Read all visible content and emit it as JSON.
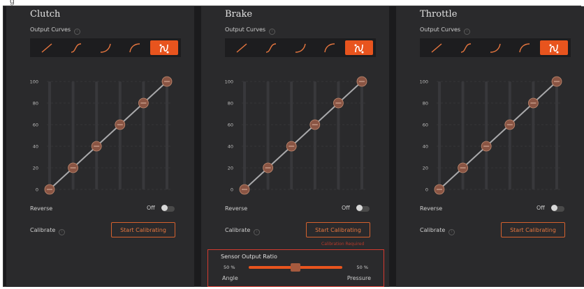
{
  "top_text": "g",
  "panels": [
    {
      "title": "Clutch",
      "output_curves_label": "Output Curves",
      "reverse_label": "Reverse",
      "reverse_state": "Off",
      "calibrate_label": "Calibrate",
      "calibrate_button": "Start Calibrating",
      "warning": ""
    },
    {
      "title": "Brake",
      "output_curves_label": "Output Curves",
      "reverse_label": "Reverse",
      "reverse_state": "Off",
      "calibrate_label": "Calibrate",
      "calibrate_button": "Start Calibrating",
      "warning": "Calibration Required"
    },
    {
      "title": "Throttle",
      "output_curves_label": "Output Curves",
      "reverse_label": "Reverse",
      "reverse_state": "Off",
      "calibrate_label": "Calibrate",
      "calibrate_button": "Start Calibrating",
      "warning": ""
    }
  ],
  "curve_presets": [
    "linear",
    "s-curve",
    "exponential",
    "logarithmic",
    "custom"
  ],
  "active_curve_index": 4,
  "curve_points": [
    0,
    20,
    40,
    60,
    80,
    100
  ],
  "y_ticks": [
    "0",
    "20",
    "40",
    "60",
    "80",
    "100"
  ],
  "sensor_ratio": {
    "title": "Sensor Output Ratio",
    "left_value": "50",
    "right_value": "50",
    "unit": "%",
    "left_label": "Angle",
    "right_label": "Pressure",
    "level": 0.5
  },
  "colors": {
    "accent": "#e8541e",
    "panel": "#2a2a2c",
    "background": "#1b1b1d",
    "warning": "#d43a2f"
  }
}
